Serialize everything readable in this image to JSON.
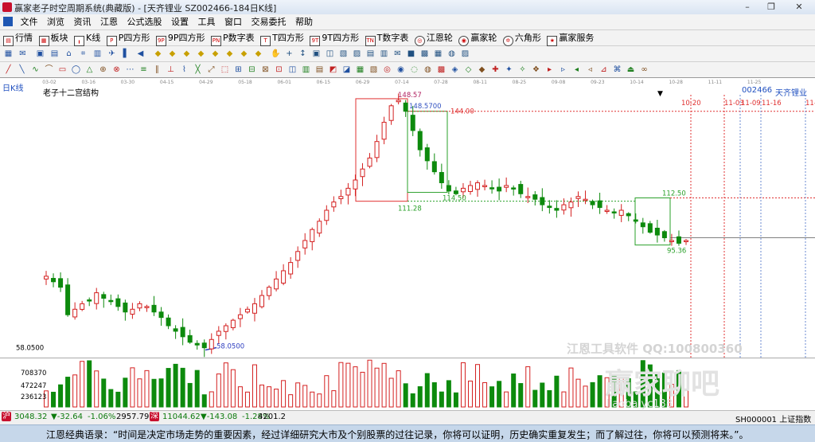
{
  "window": {
    "title": "赢家老子时空周期系统(典藏版) - [天齐锂业  SZ002466-184日K线]"
  },
  "menu": {
    "items": [
      "文件",
      "浏览",
      "资讯",
      "江恩",
      "公式选股",
      "设置",
      "工具",
      "窗口",
      "交易委托",
      "帮助"
    ]
  },
  "toolbar1": {
    "items": [
      {
        "icon": "quote-icon",
        "label": "行情"
      },
      {
        "icon": "sector-icon",
        "label": "板块"
      },
      {
        "icon": "kline-icon",
        "label": "K线"
      },
      {
        "icon": "p-square-icon",
        "label": "P四方形"
      },
      {
        "icon": "9p-square-icon",
        "label": "9P四方形"
      },
      {
        "icon": "pn-table-icon",
        "label": "P数字表"
      },
      {
        "icon": "t-square-icon",
        "label": "T四方形"
      },
      {
        "icon": "9t-square-icon",
        "label": "9T四方形"
      },
      {
        "icon": "t-table-icon",
        "label": "T数字表"
      },
      {
        "icon": "gann-wheel-icon",
        "label": "江恩轮"
      },
      {
        "icon": "winner-wheel-icon",
        "label": "赢家轮"
      },
      {
        "icon": "hexagram-icon",
        "label": "六角形"
      },
      {
        "icon": "service-icon",
        "label": "赢家服务"
      }
    ]
  },
  "chart": {
    "period_label": "日K线",
    "indicator_name": "老子十二宫结构",
    "stock_code": "002466",
    "stock_name": "天齐锂业",
    "top_axis_dates": [
      "03-02",
      "03-16",
      "03-30",
      "04-15",
      "04-29",
      "05-18",
      "06-01",
      "06-15",
      "06-29",
      "07-14",
      "07-28",
      "08-11",
      "08-25",
      "09-08",
      "09-23",
      "10-14",
      "10-28",
      "11-11",
      "11-25"
    ],
    "cycle_dates": [
      "10-20",
      "11-03",
      "11-09",
      "11-16",
      "11-"
    ],
    "price_labels": {
      "peak_high": "148.57",
      "peak_close": "148.5700",
      "level_144": "144.00",
      "box_low": "111.28",
      "box2_low": "114.50",
      "recent_high": "112.50",
      "recent_low": "95.36",
      "bottom": "58.0500"
    },
    "axis": {
      "price_floor": "58.0500",
      "vol_high": "708370",
      "vol_mid": "472247",
      "vol_low": "236123"
    },
    "watermark1": "江恩工具软件  QQ:100800360",
    "watermark2": "赢家聊吧",
    "watermark3": "liaoba.yc138",
    "colors": {
      "up": "#d42020",
      "down": "#0d8a0d",
      "box_red": "#e03030",
      "box_green": "#2aa02a",
      "bottom_line": "#3040c0"
    }
  },
  "chart_data": {
    "type": "candlestick",
    "title": "",
    "xlabel": "",
    "ylabel": "",
    "approx_closes": [
      84,
      82,
      80,
      70,
      72,
      74,
      75,
      78,
      76,
      75,
      73,
      71,
      72,
      74,
      73,
      71,
      69,
      66,
      64,
      62,
      60,
      59,
      58,
      61,
      64,
      66,
      68,
      70,
      72,
      74,
      77,
      80,
      83,
      86,
      89,
      93,
      97,
      101,
      104,
      108,
      111,
      113,
      116,
      119,
      123,
      127,
      133,
      140,
      146,
      148,
      144,
      137,
      130,
      126,
      122,
      118,
      115,
      114,
      116,
      117,
      118,
      117,
      116,
      115,
      117,
      116,
      114,
      113,
      112,
      110,
      109,
      108,
      110,
      111,
      113,
      112,
      110,
      109,
      108,
      107,
      108,
      106,
      104,
      102,
      100,
      99,
      98,
      97,
      96,
      97
    ],
    "ylim": [
      55,
      150
    ]
  },
  "status": {
    "sh_index": "3048.32",
    "sh_change": "▼-32.64",
    "sh_pct": "-1.06%",
    "sh_amount": "2957.79",
    "sz_index": "11044.62",
    "sz_change": "▼-143.08",
    "sz_pct": "-1.28%",
    "sz_amount": "4201.2",
    "current_index": "SH000001 上证指数"
  },
  "quote": {
    "text": "江恩经典语录：“时间是决定市场走势的重要因素，经过详细研究大市及个别股票的过往记录，你将可以证明，历史确实重复发生；而了解过往，你将可以预测将来。”。"
  }
}
